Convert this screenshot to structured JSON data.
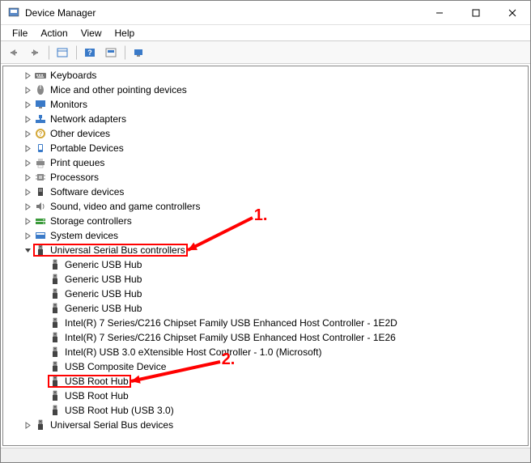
{
  "window": {
    "title": "Device Manager"
  },
  "menu": {
    "file": "File",
    "action": "Action",
    "view": "View",
    "help": "Help"
  },
  "tree": {
    "nodes": [
      {
        "indent": 1,
        "expander": "right",
        "icon": "keyboard-icon",
        "label": "Keyboards"
      },
      {
        "indent": 1,
        "expander": "right",
        "icon": "mouse-icon",
        "label": "Mice and other pointing devices"
      },
      {
        "indent": 1,
        "expander": "right",
        "icon": "monitor-icon",
        "label": "Monitors"
      },
      {
        "indent": 1,
        "expander": "right",
        "icon": "network-icon",
        "label": "Network adapters"
      },
      {
        "indent": 1,
        "expander": "right",
        "icon": "other-icon",
        "label": "Other devices"
      },
      {
        "indent": 1,
        "expander": "right",
        "icon": "portable-icon",
        "label": "Portable Devices"
      },
      {
        "indent": 1,
        "expander": "right",
        "icon": "print-icon",
        "label": "Print queues"
      },
      {
        "indent": 1,
        "expander": "right",
        "icon": "cpu-icon",
        "label": "Processors"
      },
      {
        "indent": 1,
        "expander": "right",
        "icon": "software-icon",
        "label": "Software devices"
      },
      {
        "indent": 1,
        "expander": "right",
        "icon": "sound-icon",
        "label": "Sound, video and game controllers"
      },
      {
        "indent": 1,
        "expander": "right",
        "icon": "storage-icon",
        "label": "Storage controllers"
      },
      {
        "indent": 1,
        "expander": "right",
        "icon": "system-icon",
        "label": "System devices"
      },
      {
        "indent": 1,
        "expander": "down",
        "icon": "usb-icon",
        "label": "Universal Serial Bus controllers",
        "highlight": 1
      },
      {
        "indent": 2,
        "expander": "none",
        "icon": "usb-icon",
        "label": "Generic USB Hub"
      },
      {
        "indent": 2,
        "expander": "none",
        "icon": "usb-icon",
        "label": "Generic USB Hub"
      },
      {
        "indent": 2,
        "expander": "none",
        "icon": "usb-icon",
        "label": "Generic USB Hub"
      },
      {
        "indent": 2,
        "expander": "none",
        "icon": "usb-icon",
        "label": "Generic USB Hub"
      },
      {
        "indent": 2,
        "expander": "none",
        "icon": "usb-icon",
        "label": "Intel(R) 7 Series/C216 Chipset Family USB Enhanced Host Controller - 1E2D"
      },
      {
        "indent": 2,
        "expander": "none",
        "icon": "usb-icon",
        "label": "Intel(R) 7 Series/C216 Chipset Family USB Enhanced Host Controller - 1E26"
      },
      {
        "indent": 2,
        "expander": "none",
        "icon": "usb-icon",
        "label": "Intel(R) USB 3.0 eXtensible Host Controller - 1.0 (Microsoft)"
      },
      {
        "indent": 2,
        "expander": "none",
        "icon": "usb-icon",
        "label": "USB Composite Device"
      },
      {
        "indent": 2,
        "expander": "none",
        "icon": "usb-icon",
        "label": "USB Root Hub",
        "highlight": 2
      },
      {
        "indent": 2,
        "expander": "none",
        "icon": "usb-icon",
        "label": "USB Root Hub"
      },
      {
        "indent": 2,
        "expander": "none",
        "icon": "usb-icon",
        "label": "USB Root Hub (USB 3.0)"
      },
      {
        "indent": 1,
        "expander": "right",
        "icon": "usb-icon",
        "label": "Universal Serial Bus devices"
      }
    ]
  },
  "annotations": {
    "label1": "1.",
    "label2": "2."
  }
}
